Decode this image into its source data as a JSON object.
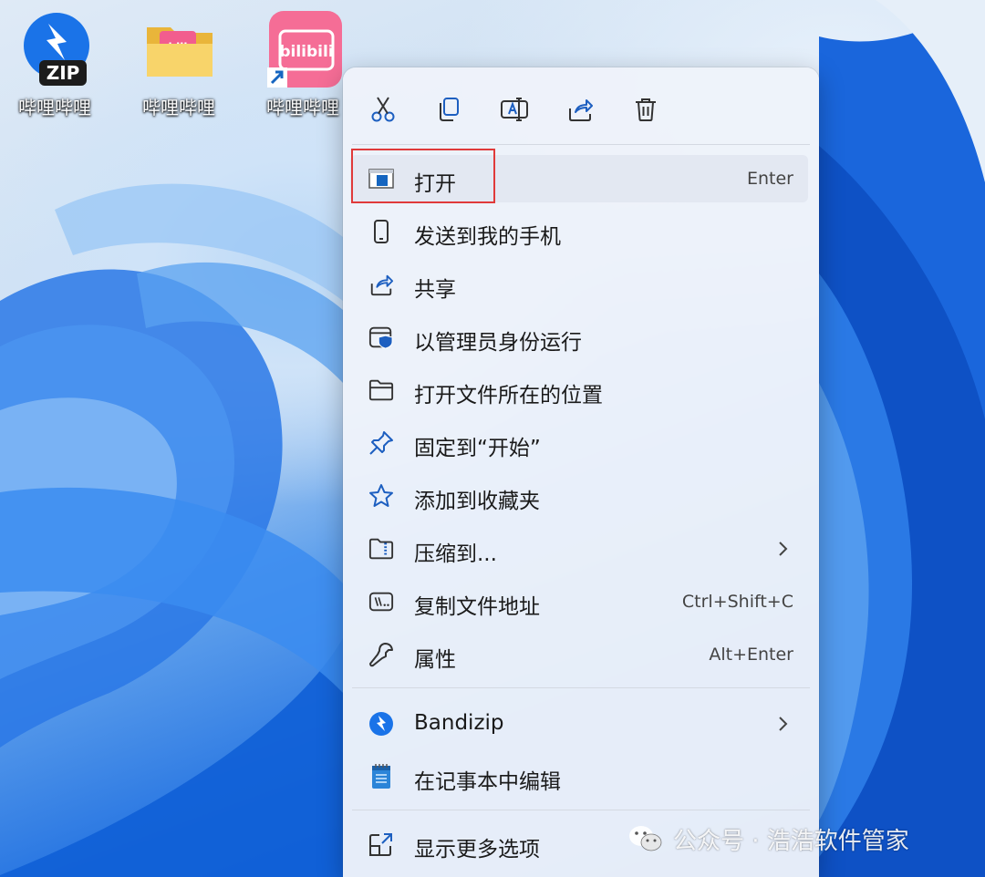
{
  "desktop": {
    "icons": [
      {
        "label": "哔哩哔哩",
        "icon": "bandizip-zip-icon"
      },
      {
        "label": "哔哩哔哩",
        "icon": "folder-icon"
      },
      {
        "label": "哔哩哔哩",
        "icon": "bilibili-shortcut-icon"
      }
    ]
  },
  "toolbar": {
    "buttons": [
      "cut-icon",
      "copy-icon",
      "rename-icon",
      "share-icon",
      "delete-icon"
    ]
  },
  "menu": {
    "items": [
      {
        "label": "打开",
        "shortcut": "Enter",
        "icon": "open-icon"
      },
      {
        "label": "发送到我的手机",
        "icon": "phone-icon"
      },
      {
        "label": "共享",
        "icon": "share-icon"
      },
      {
        "label": "以管理员身份运行",
        "icon": "shield-icon"
      },
      {
        "label": "打开文件所在的位置",
        "icon": "folder-icon"
      },
      {
        "label": "固定到“开始”",
        "icon": "pin-icon"
      },
      {
        "label": "添加到收藏夹",
        "icon": "star-icon"
      },
      {
        "label": "压缩到...",
        "icon": "zip-folder-icon",
        "submenu": true
      },
      {
        "label": "复制文件地址",
        "shortcut": "Ctrl+Shift+C",
        "icon": "path-icon"
      },
      {
        "label": "属性",
        "shortcut": "Alt+Enter",
        "icon": "wrench-icon"
      }
    ],
    "group2": [
      {
        "label": "Bandizip",
        "icon": "bandizip-icon",
        "submenu": true
      },
      {
        "label": "在记事本中编辑",
        "icon": "notepad-icon"
      }
    ],
    "group3": [
      {
        "label": "显示更多选项",
        "icon": "more-options-icon"
      }
    ]
  },
  "watermark": {
    "text": "公众号 · 浩浩软件管家",
    "icon": "wechat-icon"
  },
  "colors": {
    "highlight_box": "#e03a3a",
    "accent": "#1f6fe0"
  }
}
